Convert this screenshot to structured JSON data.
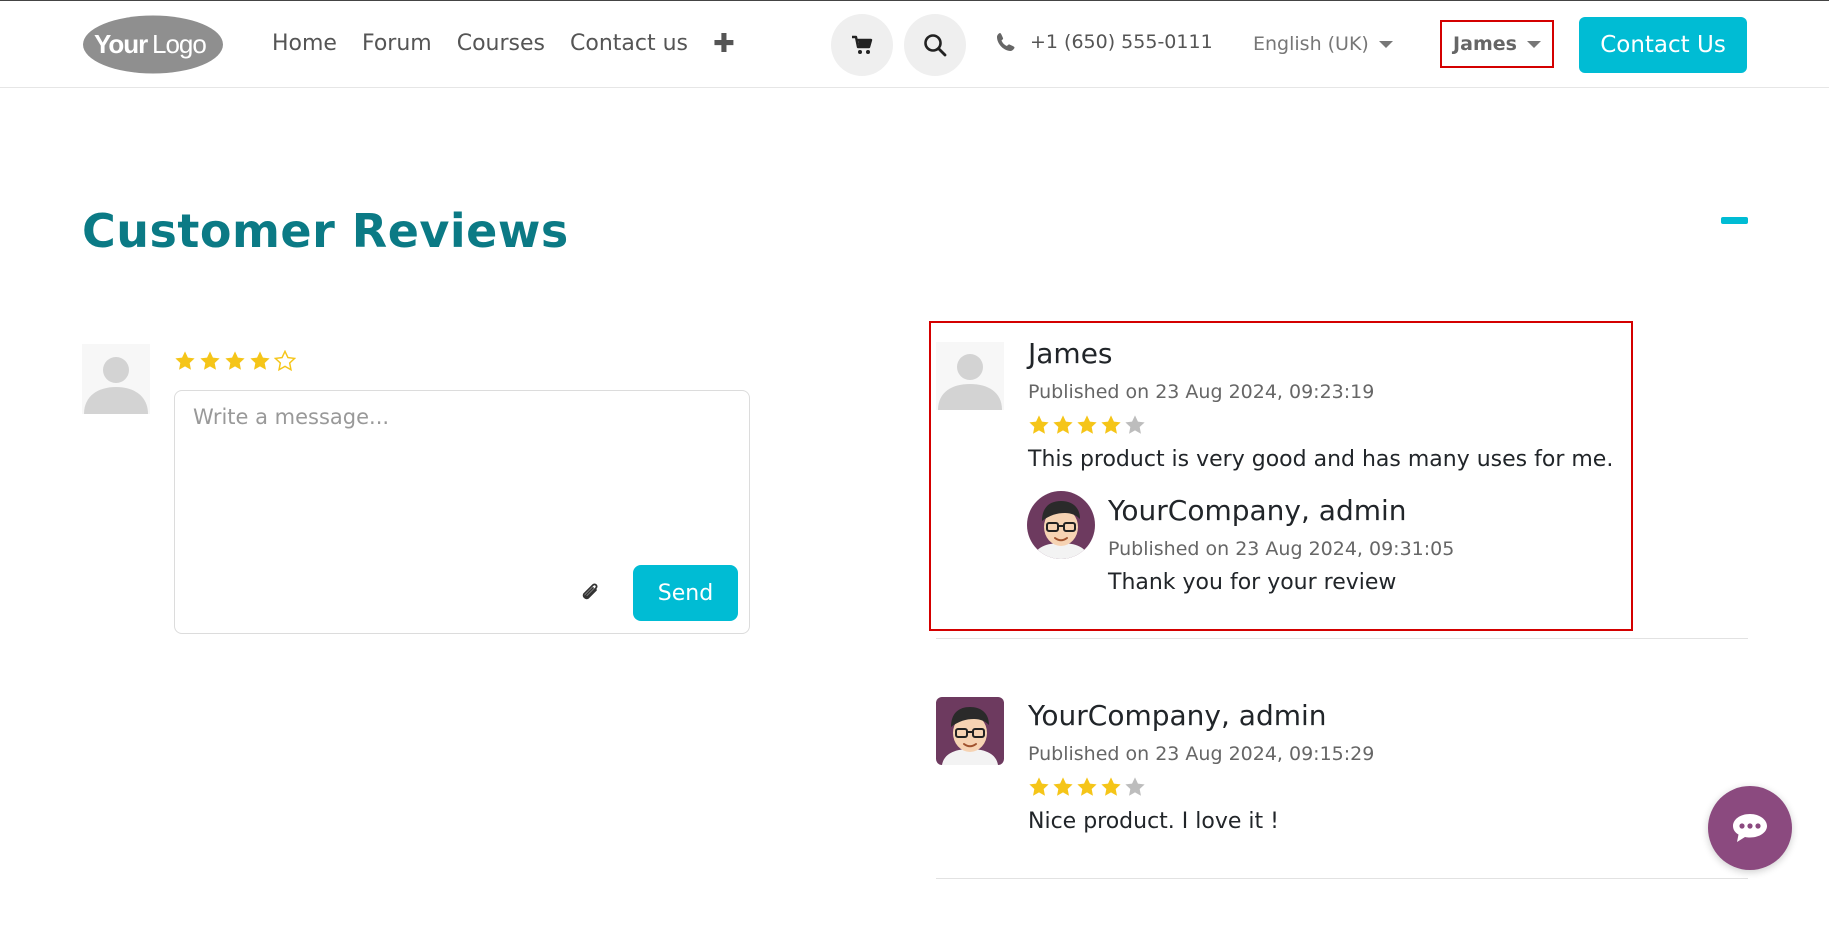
{
  "header": {
    "logo_text": "YourLogo",
    "nav": [
      {
        "label": "Home"
      },
      {
        "label": "Forum"
      },
      {
        "label": "Courses"
      },
      {
        "label": "Contact us"
      }
    ],
    "add_icon": "plus-icon",
    "phone": "+1 (650) 555-0111",
    "language": "English (UK)",
    "user": "James",
    "contact_button": "Contact Us"
  },
  "section": {
    "title": "Customer Reviews"
  },
  "composer": {
    "rating": 4,
    "max_rating": 5,
    "placeholder": "Write a message...",
    "send_label": "Send"
  },
  "reviews": [
    {
      "author": "James",
      "published": "Published on 23 Aug 2024, 09:23:19",
      "rating": 4,
      "text": "This product is very good and has many uses for me.",
      "reply": {
        "author": "YourCompany, admin",
        "published": "Published on 23 Aug 2024, 09:31:05",
        "text": "Thank you for your review"
      }
    },
    {
      "author": "YourCompany, admin",
      "published": "Published on 23 Aug 2024, 09:15:29",
      "rating": 4,
      "text": "Nice product. I love it !"
    }
  ],
  "colors": {
    "accent": "#00bcd4",
    "title": "#0b7a85",
    "star": "#f5c518",
    "highlight": "#d40000",
    "chat": "#8b4a7f"
  }
}
